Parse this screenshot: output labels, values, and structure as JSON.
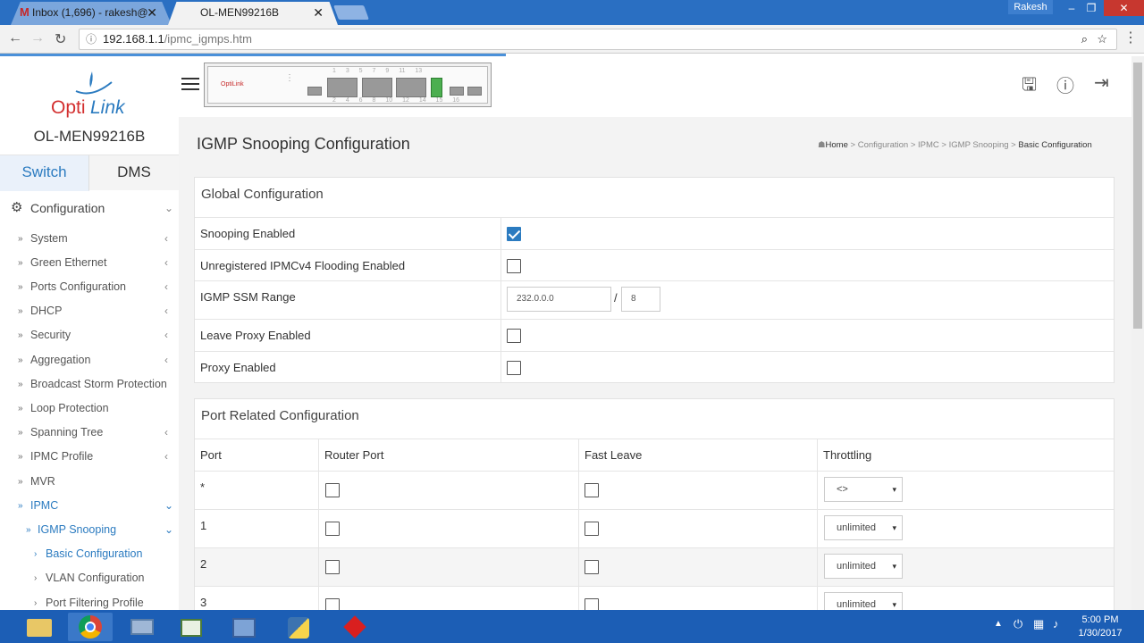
{
  "browser": {
    "tabs": [
      {
        "title": "Inbox (1,696) - rakesh@"
      },
      {
        "title": "OL-MEN99216B"
      }
    ],
    "user": "Rakesh",
    "url_host": "192.168.1.1",
    "url_path": "/ipmc_igmps.htm"
  },
  "app": {
    "logo_text": "OptiLink",
    "device_name": "OL-MEN99216B",
    "mode_tabs": [
      "Switch",
      "DMS"
    ],
    "active_mode": "Switch"
  },
  "sidebar": {
    "section": "Configuration",
    "items": [
      {
        "label": "System"
      },
      {
        "label": "Green Ethernet"
      },
      {
        "label": "Ports Configuration"
      },
      {
        "label": "DHCP"
      },
      {
        "label": "Security"
      },
      {
        "label": "Aggregation"
      },
      {
        "label": "Broadcast Storm Protection"
      },
      {
        "label": "Loop Protection"
      },
      {
        "label": "Spanning Tree"
      },
      {
        "label": "IPMC Profile"
      },
      {
        "label": "MVR"
      },
      {
        "label": "IPMC"
      },
      {
        "label": "IGMP Snooping"
      },
      {
        "label": "Basic Configuration"
      },
      {
        "label": "VLAN Configuration"
      },
      {
        "label": "Port Filtering Profile"
      }
    ]
  },
  "page": {
    "title": "IGMP Snooping Configuration",
    "breadcrumb": [
      "Home",
      "Configuration",
      "IPMC",
      "IGMP Snooping",
      "Basic Configuration"
    ]
  },
  "global": {
    "title": "Global Configuration",
    "rows": [
      {
        "label": "Snooping Enabled",
        "checked": true
      },
      {
        "label": "Unregistered IPMCv4 Flooding Enabled",
        "checked": false
      },
      {
        "label": "IGMP SSM Range",
        "ssm_address": "232.0.0.0",
        "ssm_separator": "/",
        "ssm_mask": "8"
      },
      {
        "label": "Leave Proxy Enabled",
        "checked": false
      },
      {
        "label": "Proxy Enabled",
        "checked": false
      }
    ]
  },
  "ports": {
    "title": "Port Related Configuration",
    "columns": [
      "Port",
      "Router Port",
      "Fast Leave",
      "Throttling"
    ],
    "rows": [
      {
        "port": "*",
        "router": false,
        "fast_leave": false,
        "throttling": "<>"
      },
      {
        "port": "1",
        "router": false,
        "fast_leave": false,
        "throttling": "unlimited"
      },
      {
        "port": "2",
        "router": false,
        "fast_leave": false,
        "throttling": "unlimited"
      },
      {
        "port": "3",
        "router": false,
        "fast_leave": false,
        "throttling": "unlimited"
      }
    ]
  },
  "panel": {
    "top_numbers": [
      "1",
      "3",
      "5",
      "7",
      "9",
      "11",
      "13"
    ],
    "bottom_numbers": [
      "2",
      "4",
      "6",
      "8",
      "10",
      "12",
      "14",
      "15",
      "16"
    ]
  },
  "taskbar": {
    "time": "5:00 PM",
    "date": "1/30/2017"
  },
  "colors": {
    "accent": "#2b7bc0",
    "browser_blue": "#2a6fc2",
    "taskbar": "#1c5eb5"
  }
}
